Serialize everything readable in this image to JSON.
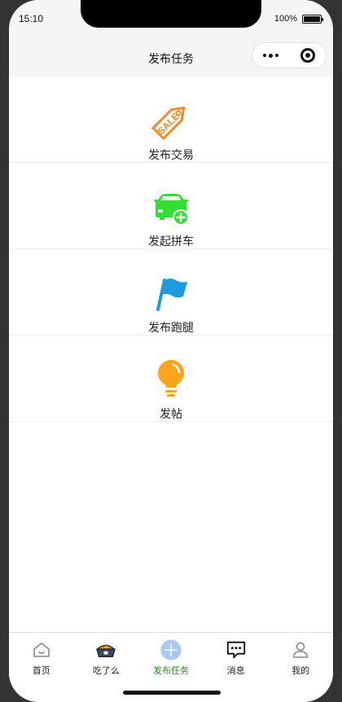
{
  "status_bar": {
    "time": "15:10",
    "battery_text": "100%",
    "battery_level": 1.0
  },
  "nav": {
    "title": "发布任务"
  },
  "menu": {
    "items": [
      {
        "label": "发布交易",
        "icon": "sale-tag-icon",
        "color": "#f28c28",
        "tag_text": "SALE"
      },
      {
        "label": "发起拼车",
        "icon": "car-add-icon",
        "color": "#33dd33"
      },
      {
        "label": "发布跑腿",
        "icon": "flag-icon",
        "color": "#1e9be0"
      },
      {
        "label": "发帖",
        "icon": "lightbulb-icon",
        "color": "#ffa41b"
      }
    ]
  },
  "tabbar": {
    "active_color": "#2a8c2a",
    "tabs": [
      {
        "label": "首页",
        "icon": "home-icon"
      },
      {
        "label": "吃了么",
        "icon": "food-bowl-icon"
      },
      {
        "label": "发布任务",
        "icon": "plus-circle-icon",
        "active": true
      },
      {
        "label": "消息",
        "icon": "message-icon"
      },
      {
        "label": "我的",
        "icon": "user-icon"
      }
    ]
  }
}
